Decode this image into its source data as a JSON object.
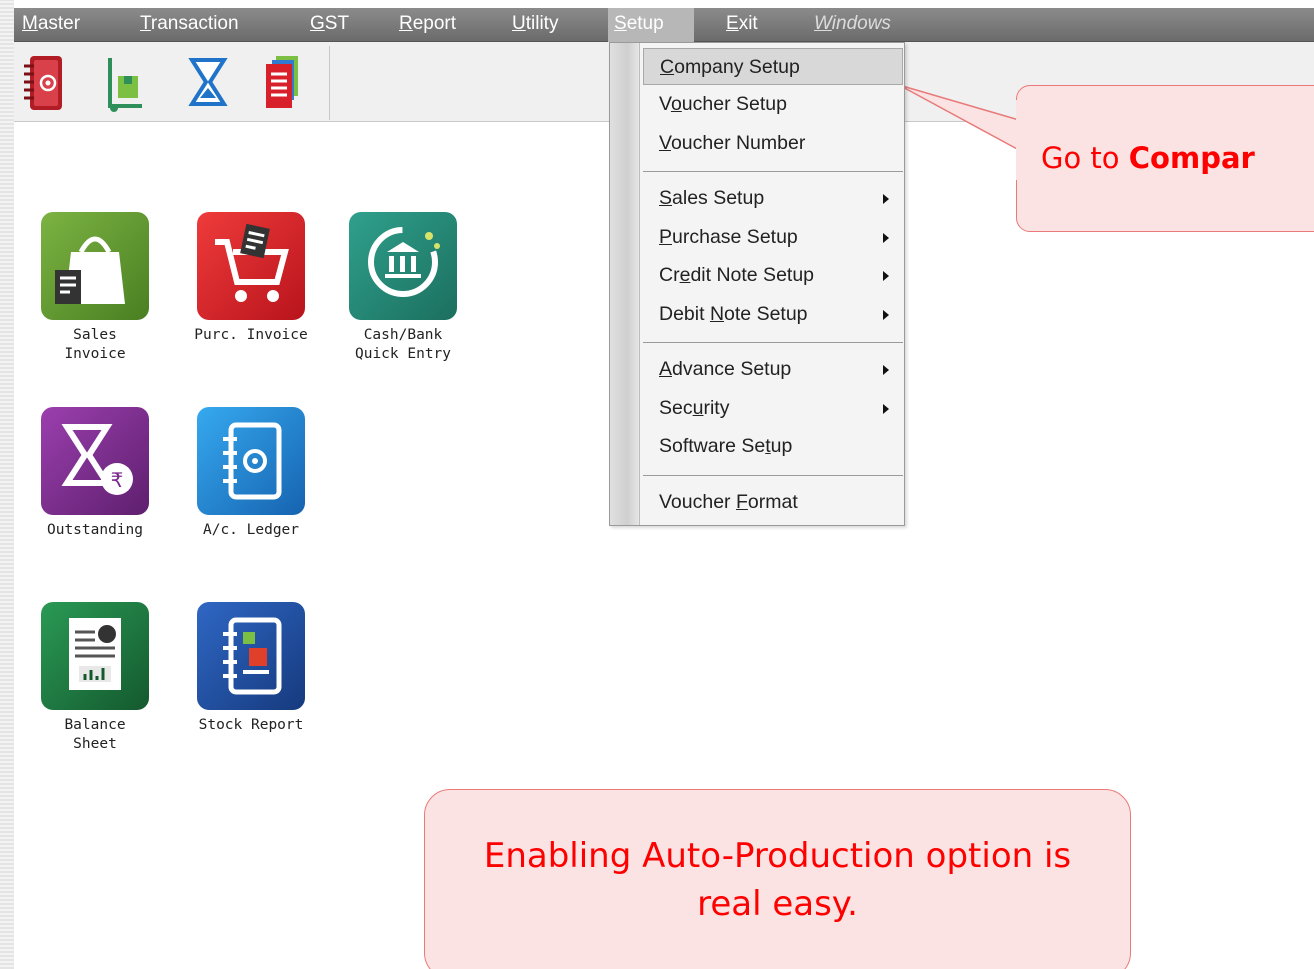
{
  "menubar": {
    "items": [
      "Master",
      "Transaction",
      "GST",
      "Report",
      "Utility",
      "Setup",
      "Exit",
      "Windows"
    ]
  },
  "toolbar": {
    "icons": [
      "ledger-book-icon",
      "stock-trolley-icon",
      "hourglass-sigma-icon",
      "document-stack-icon"
    ]
  },
  "tiles": [
    {
      "label": "Sales\nInvoice",
      "icon": "sales-invoice-bag-icon",
      "color": "#5a8e2f"
    },
    {
      "label": "Purc. Invoice",
      "icon": "purchase-cart-icon",
      "color": "#d7202a"
    },
    {
      "label": "Cash/Bank\nQuick Entry",
      "icon": "bank-icon",
      "color": "#2a8a77"
    },
    {
      "label": "Outstanding",
      "icon": "hourglass-rupee-icon",
      "color": "#7b2a8c"
    },
    {
      "label": "A/c. Ledger",
      "icon": "ledger-icon",
      "color": "#1f8dd6"
    },
    {
      "label": "Balance\nSheet",
      "icon": "balance-sheet-icon",
      "color": "#1f7a42"
    },
    {
      "label": "Stock Report",
      "icon": "stock-report-icon",
      "color": "#1d4d9a"
    }
  ],
  "setup_menu": {
    "items": [
      {
        "label": "Company Setup",
        "submenu": false
      },
      {
        "label": "Voucher Setup",
        "submenu": false
      },
      {
        "label": "Voucher Number",
        "submenu": false
      },
      {
        "label": "Sales Setup",
        "submenu": true
      },
      {
        "label": "Purchase Setup",
        "submenu": true
      },
      {
        "label": "Credit Note Setup",
        "submenu": true
      },
      {
        "label": "Debit Note Setup",
        "submenu": true
      },
      {
        "label": "Advance Setup",
        "submenu": true
      },
      {
        "label": "Security",
        "submenu": true
      },
      {
        "label": "Software Setup",
        "submenu": false
      },
      {
        "label": "Voucher Format",
        "submenu": false
      }
    ]
  },
  "callouts": {
    "top_prefix": "Go to ",
    "top_bold": "Compar",
    "bottom_line1": "Enabling Auto-Production option is",
    "bottom_line2": "real easy."
  },
  "colors": {
    "callout_text": "#ff0000",
    "callout_fill": "#fbe3e3",
    "callout_border": "#e87a7a",
    "menubar": "#7a7a7a"
  }
}
